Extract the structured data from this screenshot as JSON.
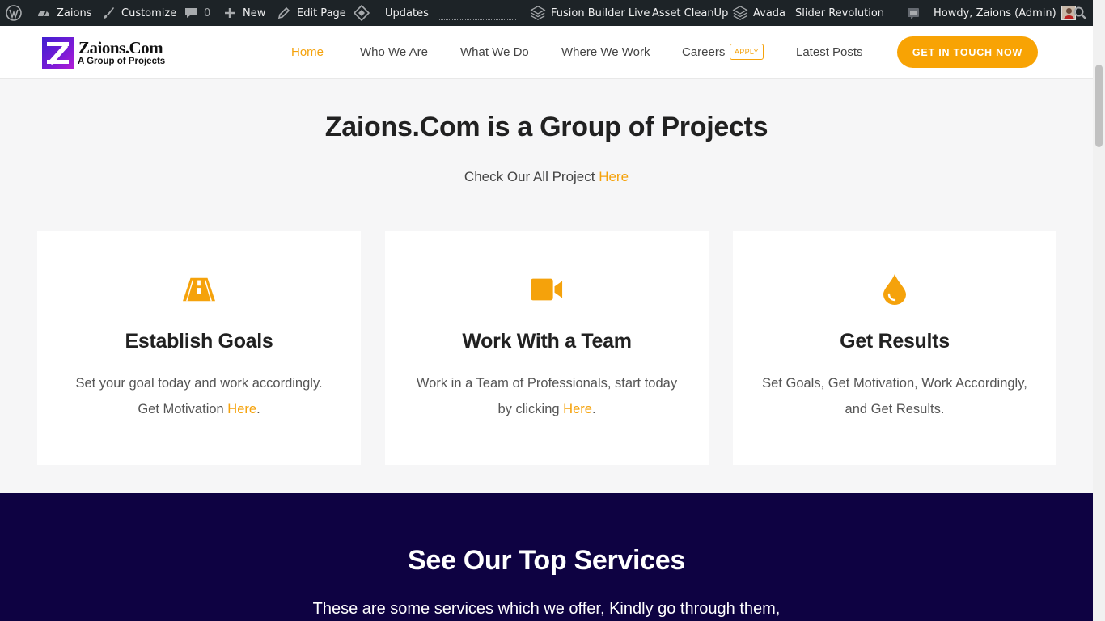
{
  "adminbar": {
    "site_name": "Zaions",
    "customize": "Customize",
    "comments_count": "0",
    "new": "New",
    "edit_page": "Edit Page",
    "updates": "Updates",
    "fusion": "Fusion Builder Live",
    "asset_cleanup": "Asset CleanUp",
    "avada": "Avada",
    "slider": "Slider Revolution",
    "howdy": "Howdy, Zaions (Admin)"
  },
  "header": {
    "logo_brand": "Zaions.Com",
    "logo_tagline": "A Group of Projects",
    "nav": {
      "home": "Home",
      "who": "Who We Are",
      "what": "What We Do",
      "where": "Where We Work",
      "careers": "Careers",
      "apply_badge": "APPLY",
      "latest": "Latest Posts"
    },
    "cta": "GET IN TOUCH NOW"
  },
  "intro": {
    "title": "Zaions.Com is a Group of Projects",
    "subtitle_prefix": "Check Our All Project ",
    "subtitle_link": "Here"
  },
  "cards": [
    {
      "icon": "road-icon",
      "title": "Establish Goals",
      "line1": "Set your goal today and work accordingly.",
      "line2_prefix": "Get Motivation ",
      "link": "Here",
      "suffix": "."
    },
    {
      "icon": "video-camera-icon",
      "title": "Work With a Team",
      "line1": "Work in a Team of Professionals, start today",
      "line2_prefix": "by clicking ",
      "link": "Here",
      "suffix": "."
    },
    {
      "icon": "drop-icon",
      "title": "Get Results",
      "line1": "Set Goals, Get Motivation, Work Accordingly,",
      "line2_prefix": "and Get Results.",
      "link": "",
      "suffix": ""
    }
  ],
  "services": {
    "title": "See Our Top Services",
    "text": "These are some services which we offer, Kindly go through them,"
  },
  "colors": {
    "accent": "#f5a20b",
    "adminbar": "#1d2327",
    "services_bg": "#0e0242"
  }
}
